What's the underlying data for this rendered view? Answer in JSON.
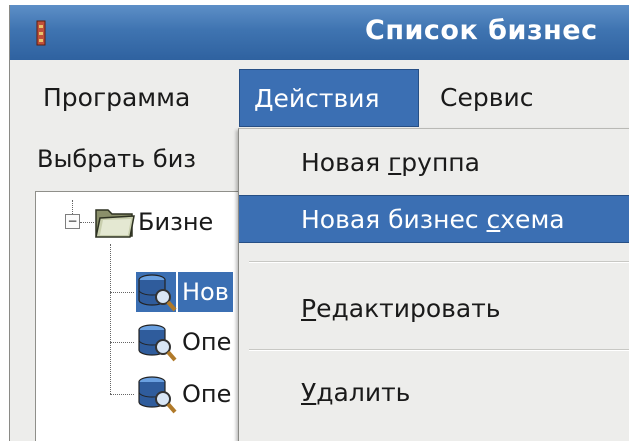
{
  "window": {
    "title": "Список бизнес"
  },
  "menubar": {
    "items": [
      {
        "label": "Программа"
      },
      {
        "label": "Действия"
      },
      {
        "label": "Сервис"
      }
    ]
  },
  "panel": {
    "select_label": "Выбрать биз"
  },
  "tree": {
    "root_label": "Бизне",
    "children": [
      {
        "label": "Нов"
      },
      {
        "label": "Опе"
      },
      {
        "label": "Опе"
      }
    ]
  },
  "dropdown": {
    "new_group": {
      "before": "Новая ",
      "mnemonic": "г",
      "after": "руппа"
    },
    "new_scheme": {
      "before": "Новая бизнес ",
      "mnemonic": "с",
      "after": "хема"
    },
    "edit": {
      "before": "",
      "mnemonic": "Р",
      "after": "едактировать"
    },
    "delete": {
      "before": "",
      "mnemonic": "У",
      "after": "далить"
    }
  },
  "colors": {
    "titlebar": "#3f74b1",
    "selection": "#3b6fb3",
    "background": "#ededeb"
  },
  "icons": [
    "app-icon",
    "folder-icon",
    "database-search-icon"
  ]
}
